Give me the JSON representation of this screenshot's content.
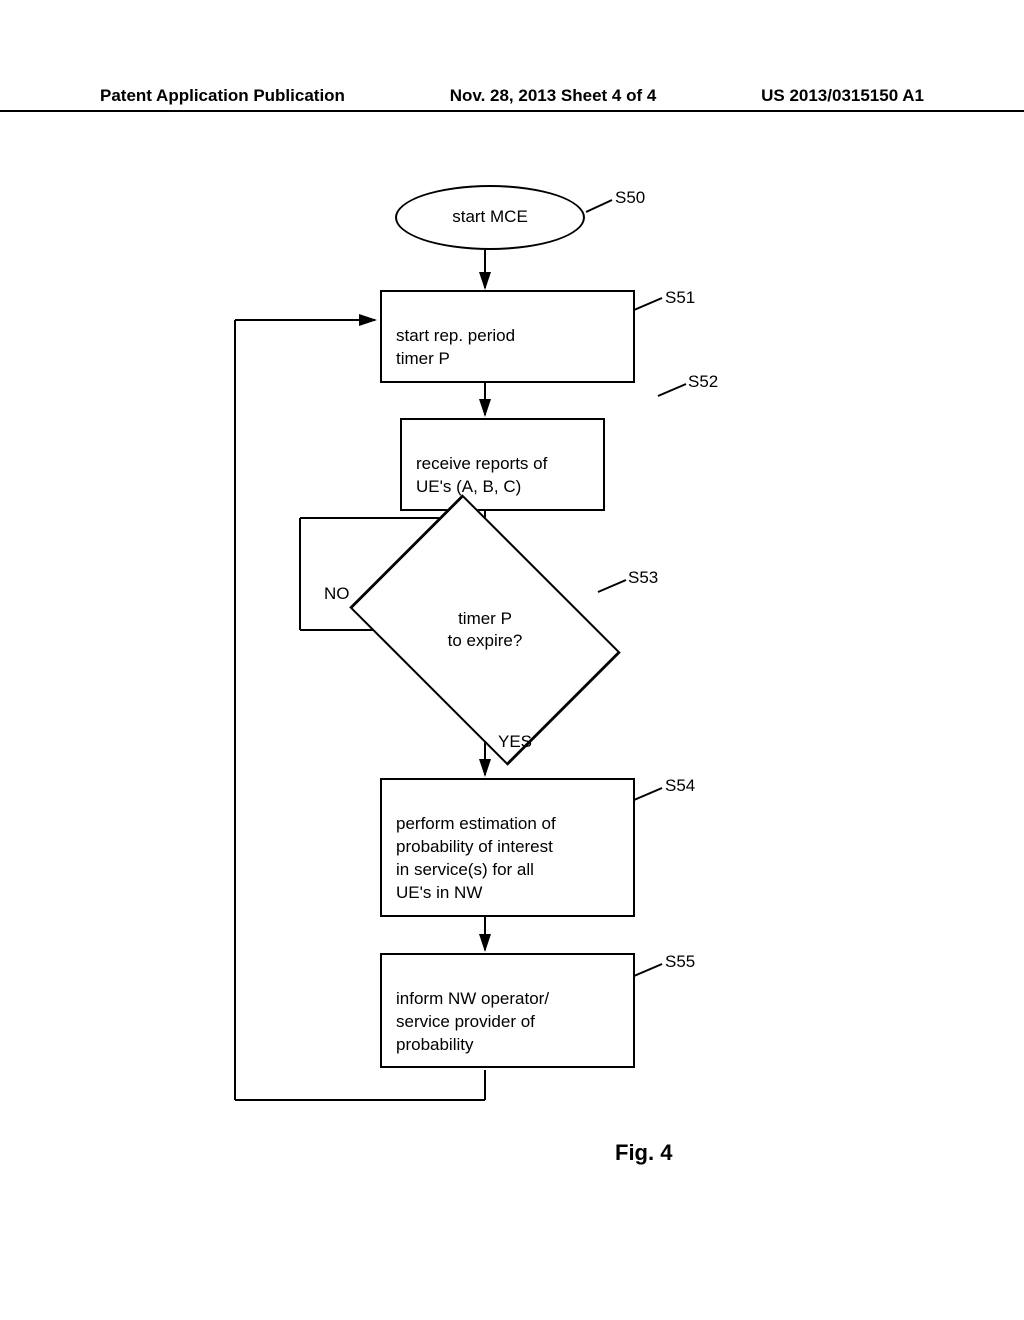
{
  "header": {
    "left": "Patent Application Publication",
    "center": "Nov. 28, 2013  Sheet 4 of 4",
    "right": "US 2013/0315150 A1"
  },
  "flow": {
    "s50": {
      "label": "start MCE",
      "tag": "S50"
    },
    "s51": {
      "label": "start rep. period\ntimer P",
      "tag": "S51"
    },
    "s52": {
      "label": "receive reports of\nUE's (A, B, C)",
      "tag": "S52"
    },
    "s53": {
      "label": "timer P\nto expire?",
      "tag": "S53",
      "no": "NO",
      "yes": "YES"
    },
    "s54": {
      "label": "perform estimation of\nprobability of interest\nin service(s) for all\nUE's in NW",
      "tag": "S54"
    },
    "s55": {
      "label": "inform NW operator/\nservice provider of\nprobability",
      "tag": "S55"
    }
  },
  "figure_caption": "Fig. 4"
}
